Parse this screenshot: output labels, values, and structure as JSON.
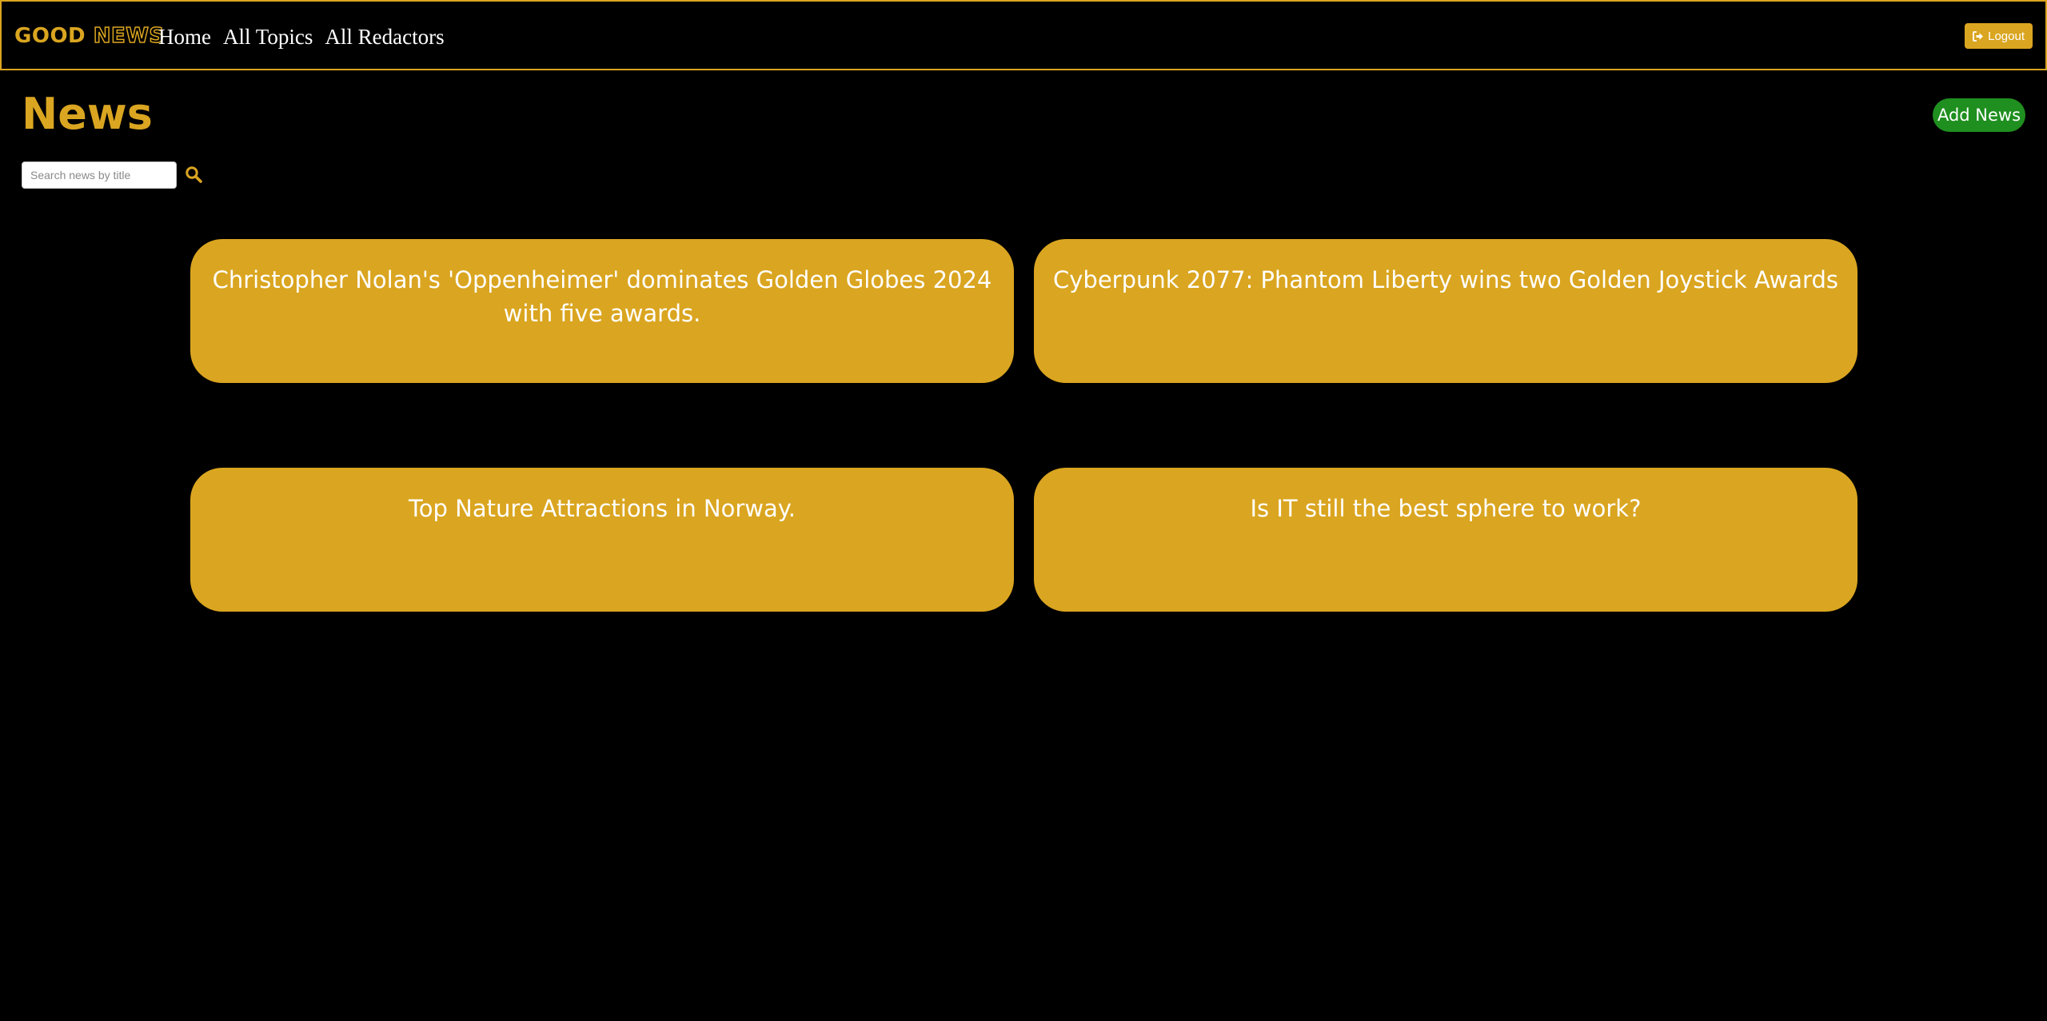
{
  "navbar": {
    "brand_good": "GOOD",
    "brand_news": "NEWS",
    "links": [
      {
        "label": "Home"
      },
      {
        "label": "All Topics"
      },
      {
        "label": "All Redactors"
      }
    ],
    "logout": {
      "label": "Logout",
      "icon": "sign-out-icon"
    }
  },
  "page": {
    "title": "News",
    "add_button": "Add News"
  },
  "search": {
    "placeholder": "Search news by title",
    "value": "",
    "icon": "search-icon"
  },
  "news": [
    {
      "title": "Christopher Nolan's 'Oppenheimer' dominates Golden Globes 2024 with five awards."
    },
    {
      "title": "Cyberpunk 2077: Phantom Liberty wins two Golden Joystick Awards"
    },
    {
      "title": "Top Nature Attractions in Norway."
    },
    {
      "title": "Is IT still the best sphere to work?"
    }
  ],
  "colors": {
    "background": "#000000",
    "accent": "#daa520",
    "add_button": "#1f8f1f",
    "text": "#ffffff"
  }
}
